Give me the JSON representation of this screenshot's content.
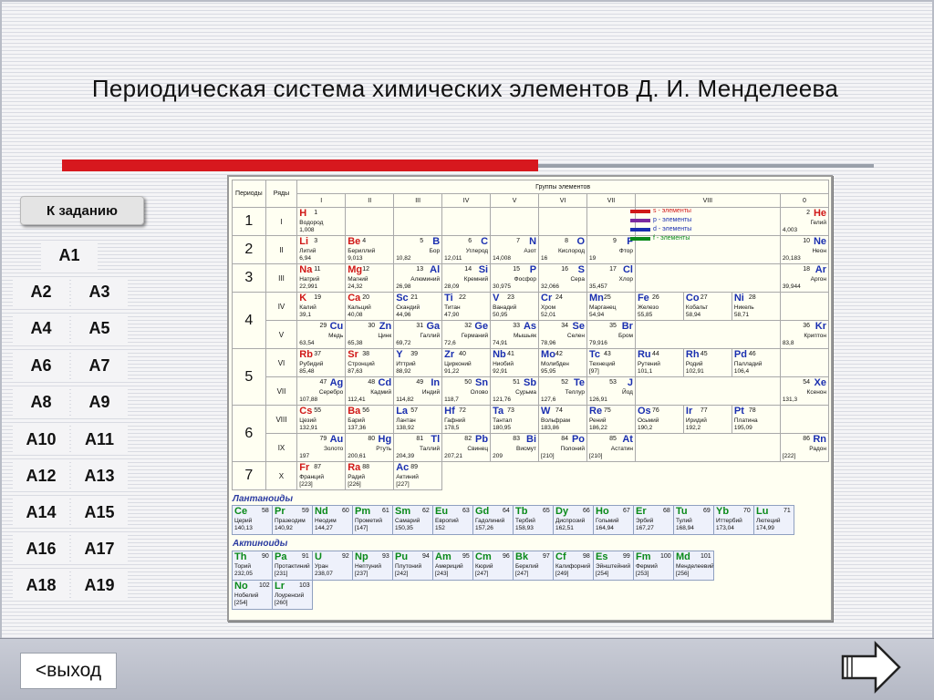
{
  "title": "Периодическая система химических элементов Д. И. Менделеева",
  "task_button": "К заданию",
  "questions": [
    "A1",
    "A2",
    "A3",
    "A4",
    "A5",
    "A6",
    "A7",
    "A8",
    "A9",
    "A10",
    "A11",
    "A12",
    "A13",
    "A14",
    "A15",
    "A16",
    "A17",
    "A18",
    "A19"
  ],
  "exit_button": "<выход",
  "colors": {
    "accent_red": "#d7181e",
    "s": "#d01818",
    "p": "#1a2fb0",
    "d": "#1a2fb0",
    "f": "#0a8a1a"
  },
  "table": {
    "periods_header": "Периоды",
    "rows_header": "Ряды",
    "groups_header": "Группы элементов",
    "groups": [
      "I",
      "II",
      "III",
      "IV",
      "V",
      "VI",
      "VII",
      "VIII",
      "0"
    ],
    "legend": [
      "s - элементы",
      "p - элементы",
      "d - элементы",
      "f - элементы"
    ],
    "lanthanides_title": "Лантаноиды",
    "actinides_title": "Актиноиды"
  }
}
